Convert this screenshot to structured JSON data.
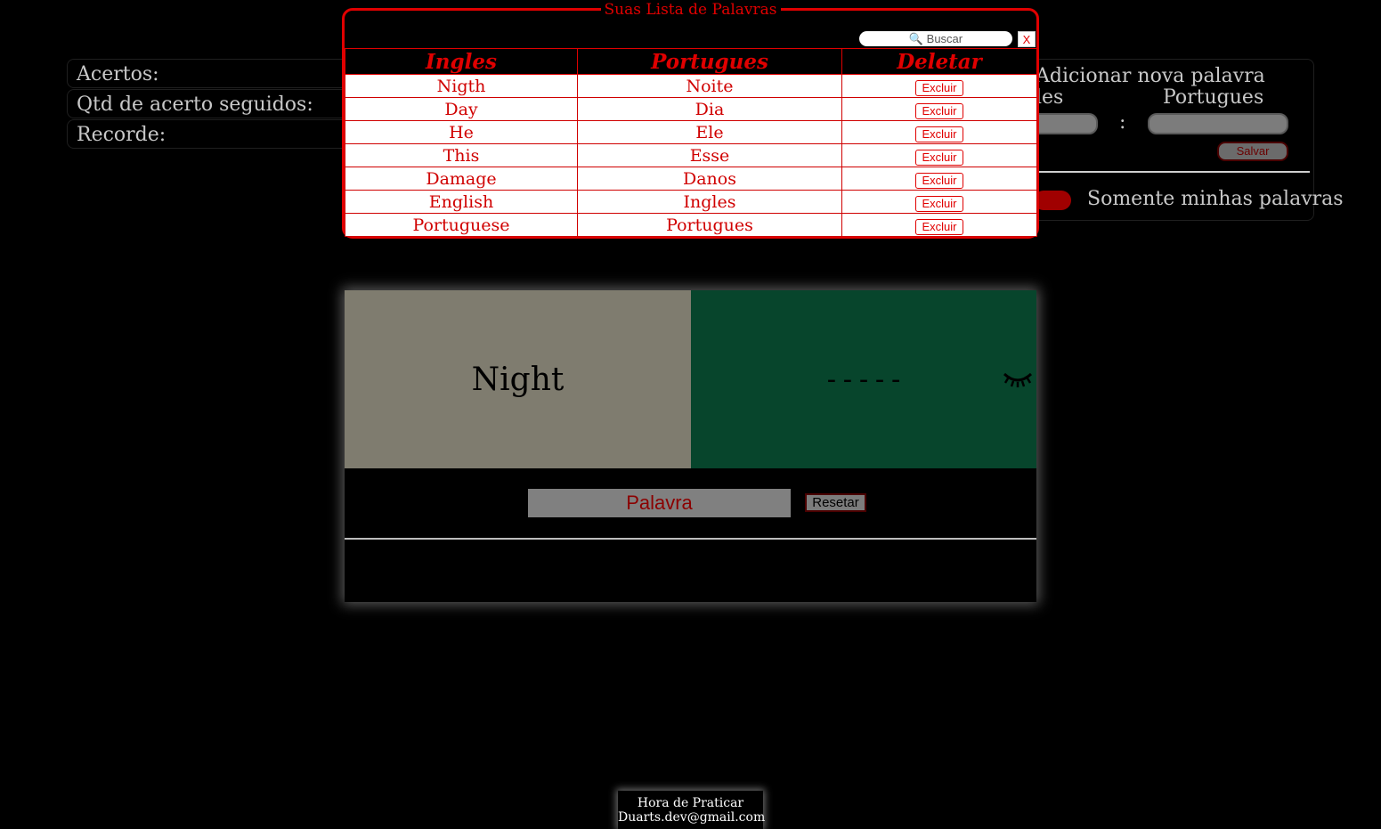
{
  "stats": {
    "hits_label": "Acertos:",
    "streak_label": "Qtd de acerto seguidos:",
    "record_label": "Recorde:"
  },
  "add_word": {
    "title": "Adicionar nova palavra",
    "english_label": "les",
    "portuguese_label": "Portugues",
    "separator": ":",
    "save_label": "Salvar",
    "only_mine_label": "Somente minhas palavras"
  },
  "modal": {
    "title": "Suas Lista de Palavras",
    "search_placeholder": "🔍 Buscar",
    "close_label": "X",
    "headers": [
      "Ingles",
      "Portugues",
      "Deletar"
    ],
    "delete_label": "Excluir",
    "rows": [
      {
        "en": "Nigth",
        "pt": "Noite"
      },
      {
        "en": "Day",
        "pt": "Dia"
      },
      {
        "en": "He",
        "pt": "Ele"
      },
      {
        "en": "This",
        "pt": "Esse"
      },
      {
        "en": "Damage",
        "pt": "Danos"
      },
      {
        "en": "English",
        "pt": "Ingles"
      },
      {
        "en": "Portuguese",
        "pt": "Portugues"
      }
    ]
  },
  "game": {
    "prompt_word": "Night",
    "hidden_answer": "-----",
    "input_placeholder": "Palavra",
    "reset_label": "Resetar"
  },
  "footer": {
    "line1": "Hora de Praticar",
    "line2": "Duarts.dev@gmail.com"
  },
  "colors": {
    "accent": "#e00000",
    "card_left": "#7f7c6f",
    "card_right": "#07452c"
  }
}
